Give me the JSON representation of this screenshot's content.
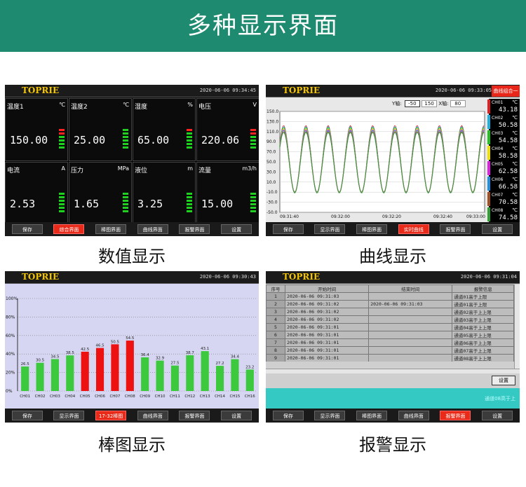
{
  "header": {
    "title": "多种显示界面"
  },
  "captions": [
    "数值显示",
    "曲线显示",
    "棒图显示",
    "报警显示"
  ],
  "brand": "TOPRIE",
  "datetime": "2020-06-06 09:34:45",
  "datetime_b": "2020-06-06 09:33:05",
  "datetime_c": "2020-06-06 09:30:43",
  "datetime_d": "2020-06-06 09:31:04",
  "numeric": {
    "cells": [
      {
        "label": "温度1",
        "unit": "℃",
        "value": "150.00"
      },
      {
        "label": "温度2",
        "unit": "℃",
        "value": "25.00"
      },
      {
        "label": "湿度",
        "unit": "%",
        "value": "65.00"
      },
      {
        "label": "电压",
        "unit": "V",
        "value": "220.06"
      },
      {
        "label": "电流",
        "unit": "A",
        "value": "2.53"
      },
      {
        "label": "压力",
        "unit": "MPa",
        "value": "1.65"
      },
      {
        "label": "液位",
        "unit": "m",
        "value": "3.25"
      },
      {
        "label": "流量",
        "unit": "m3/h",
        "value": "15.00"
      }
    ],
    "buttons": [
      "保存",
      "综合界面",
      "棒图界面",
      "曲线界面",
      "报警界面",
      "设置"
    ]
  },
  "trend": {
    "group_btn": "曲线组合一",
    "y_label": "Y轴:",
    "y_min": "-50",
    "y_max": "150",
    "x_label": "X轴:",
    "x_val": "80",
    "yticks": [
      "150.0",
      "130.0",
      "110.0",
      "90.0",
      "70.0",
      "50.0",
      "30.0",
      "10.0",
      "-10.0",
      "-30.0",
      "-50.0"
    ],
    "xticks": [
      "09:31:40",
      "09:32:00",
      "09:32:20",
      "09:32:40",
      "09:33:00"
    ],
    "channels": [
      {
        "name": "CH01",
        "unit": "℃",
        "value": "43.18",
        "color": "#e02020"
      },
      {
        "name": "CH02",
        "unit": "℃",
        "value": "50.58",
        "color": "#20b0e0"
      },
      {
        "name": "CH03",
        "unit": "℃",
        "value": "54.58",
        "color": "#20c020"
      },
      {
        "name": "CH04",
        "unit": "℃",
        "value": "58.58",
        "color": "#f0e000"
      },
      {
        "name": "CH05",
        "unit": "℃",
        "value": "62.58",
        "color": "#e020e0"
      },
      {
        "name": "CH06",
        "unit": "℃",
        "value": "66.58",
        "color": "#2090e0"
      },
      {
        "name": "CH07",
        "unit": "℃",
        "value": "70.58",
        "color": "#a05020"
      },
      {
        "name": "CH08",
        "unit": "℃",
        "value": "74.58",
        "color": "#30a030"
      }
    ],
    "buttons": [
      "保存",
      "显示界面",
      "棒图界面",
      "实时曲线",
      "报警界面",
      "设置"
    ]
  },
  "bar": {
    "buttons": [
      "保存",
      "显示界面",
      "17-32棒图",
      "曲线界面",
      "报警界面",
      "设置"
    ]
  },
  "alarm": {
    "headers": [
      "序号",
      "开始时间",
      "结束时间",
      "报警信息"
    ],
    "rows": [
      {
        "no": "1",
        "start": "2020-06-06 09:31:03",
        "end": "",
        "msg": "通道01高于上限"
      },
      {
        "no": "2",
        "start": "2020-06-06 09:31:02",
        "end": "2020-06-06 09:31:03",
        "msg": "通道01高于上限"
      },
      {
        "no": "3",
        "start": "2020-06-06 09:31:02",
        "end": "",
        "msg": "通道02高于上上限"
      },
      {
        "no": "4",
        "start": "2020-06-06 09:31:02",
        "end": "",
        "msg": "通道03高于上上限"
      },
      {
        "no": "5",
        "start": "2020-06-06 09:31:01",
        "end": "",
        "msg": "通道04高于上上限"
      },
      {
        "no": "6",
        "start": "2020-06-06 09:31:01",
        "end": "",
        "msg": "通道05高于上上限"
      },
      {
        "no": "7",
        "start": "2020-06-06 09:31:01",
        "end": "",
        "msg": "通道06高于上上限"
      },
      {
        "no": "8",
        "start": "2020-06-06 09:31:01",
        "end": "",
        "msg": "通道07高于上上限"
      },
      {
        "no": "9",
        "start": "2020-06-06 09:31:01",
        "end": "",
        "msg": "通道08高于上上限"
      }
    ],
    "settings_btn": "设置",
    "status_text": "通道08高于上",
    "buttons": [
      "保存",
      "显示界面",
      "棒图界面",
      "曲线界面",
      "报警界面",
      "设置"
    ]
  },
  "chart_data": {
    "type": "bar",
    "categories": [
      "CH01",
      "CH02",
      "CH03",
      "CH04",
      "CH05",
      "CH06",
      "CH07",
      "CH08",
      "CH09",
      "CH10",
      "CH11",
      "CH12",
      "CH13",
      "CH14",
      "CH15",
      "CH16"
    ],
    "values": [
      26.5,
      30.5,
      34.5,
      38.5,
      42.5,
      46.5,
      50.5,
      54.5,
      36.4,
      32.9,
      27.5,
      38.7,
      43.1,
      27.2,
      34.4,
      23.2
    ],
    "labels": [
      "26.5",
      "30.5",
      "34.5",
      "38.5",
      "42.5",
      "46.5",
      "50.5",
      "54.5",
      "36.4",
      "32.9",
      "27.5",
      "38.7",
      "43.1",
      "27.2",
      "34.4",
      "23.2"
    ],
    "alarm": [
      false,
      false,
      false,
      false,
      true,
      true,
      true,
      true,
      false,
      false,
      false,
      false,
      false,
      false,
      false,
      false
    ],
    "yticks": [
      "100%",
      "80%",
      "60%",
      "40%",
      "20%",
      "0%"
    ],
    "ylim": [
      0,
      100
    ],
    "colors": {
      "normal": "#3dc93d",
      "alarm": "#ee1111"
    }
  }
}
